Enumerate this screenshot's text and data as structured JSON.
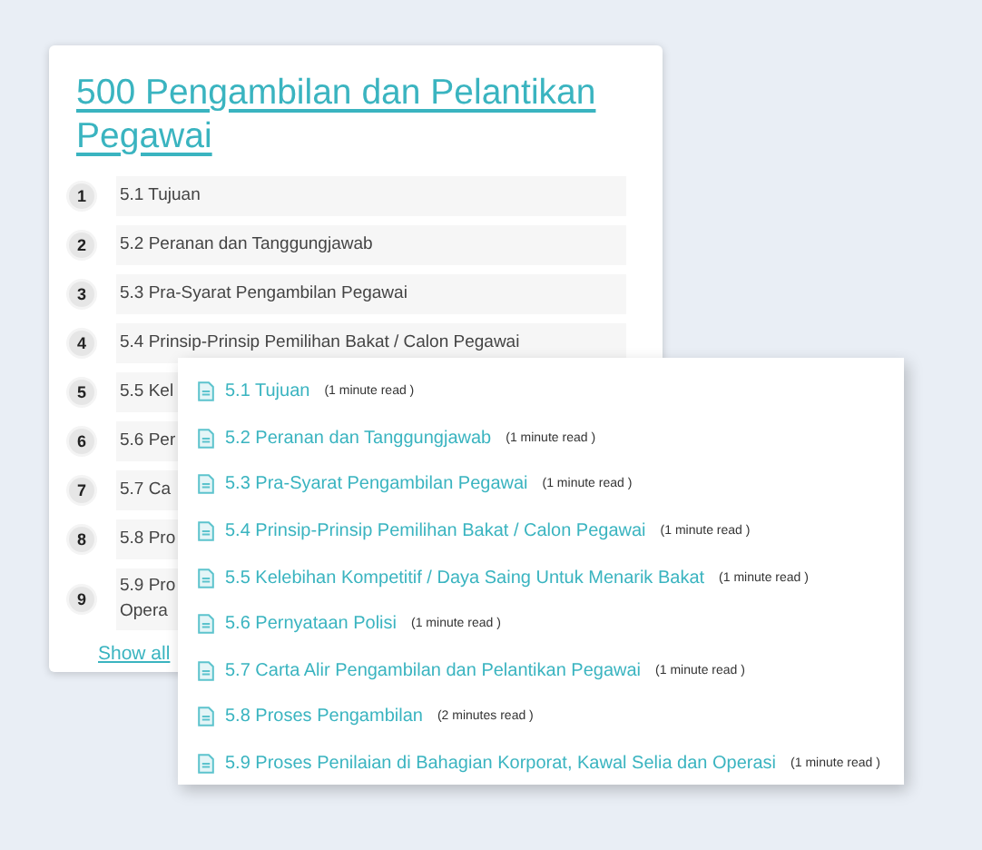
{
  "card": {
    "title": "500 Pengambilan dan Pelantikan Pegawai",
    "items": [
      {
        "number": "1",
        "lines": [
          "5.1 Tujuan"
        ]
      },
      {
        "number": "2",
        "lines": [
          "5.2 Peranan dan Tanggungjawab"
        ]
      },
      {
        "number": "3",
        "lines": [
          "5.3 Pra-Syarat Pengambilan Pegawai"
        ]
      },
      {
        "number": "4",
        "lines": [
          "5.4 Prinsip-Prinsip Pemilihan Bakat / Calon Pegawai"
        ]
      },
      {
        "number": "5",
        "lines": [
          "5.5 Kel"
        ]
      },
      {
        "number": "6",
        "lines": [
          "5.6 Per"
        ]
      },
      {
        "number": "7",
        "lines": [
          "5.7 Ca"
        ]
      },
      {
        "number": "8",
        "lines": [
          "5.8 Pro"
        ]
      },
      {
        "number": "9",
        "lines": [
          "5.9 Pro",
          "Opera"
        ]
      }
    ],
    "show_all": "Show all"
  },
  "popup": {
    "items": [
      {
        "title": "5.1 Tujuan",
        "read_time": "(1 minute read )"
      },
      {
        "title": "5.2 Peranan dan Tanggungjawab",
        "read_time": "(1 minute read )"
      },
      {
        "title": "5.3 Pra-Syarat Pengambilan Pegawai",
        "read_time": "(1 minute read )"
      },
      {
        "title": "5.4 Prinsip-Prinsip Pemilihan Bakat / Calon Pegawai",
        "read_time": "(1 minute read )"
      },
      {
        "title": "5.5 Kelebihan Kompetitif / Daya Saing Untuk Menarik Bakat",
        "read_time": "(1 minute read )"
      },
      {
        "title": "5.6 Pernyataan Polisi",
        "read_time": "(1 minute read )"
      },
      {
        "title": "5.7 Carta Alir Pengambilan dan Pelantikan Pegawai",
        "read_time": "(1 minute read )"
      },
      {
        "title": "5.8 Proses Pengambilan",
        "read_time": "(2 minutes read )"
      },
      {
        "title": "5.9 Proses Penilaian di Bahagian Korporat, Kawal Selia dan Operasi",
        "read_time": "(1 minute read )"
      }
    ]
  }
}
